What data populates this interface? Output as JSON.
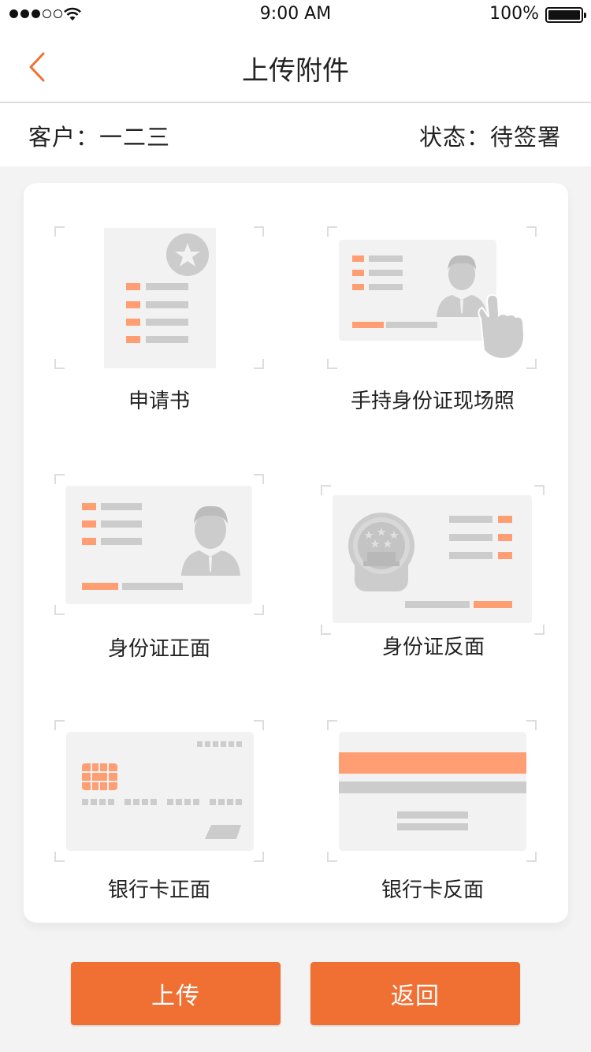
{
  "status_bar": {
    "time": "9:00 AM",
    "battery": "100%",
    "signal_icon": "signal-dots-icon",
    "wifi_icon": "wifi-icon",
    "battery_icon": "battery-icon"
  },
  "nav": {
    "title": "上传附件",
    "back_icon": "chevron-left-icon"
  },
  "info": {
    "customer_label": "客户：",
    "customer_name": "一二三",
    "status_label": "状态：",
    "status_value": "待签署"
  },
  "attachments": [
    {
      "label": "申请书",
      "icon": "application-form-icon"
    },
    {
      "label": "手持身份证现场照",
      "icon": "hand-held-id-icon"
    },
    {
      "label": "身份证正面",
      "icon": "id-card-front-icon"
    },
    {
      "label": "身份证反面",
      "icon": "id-card-back-icon"
    },
    {
      "label": "银行卡正面",
      "icon": "bank-card-front-icon"
    },
    {
      "label": "银行卡反面",
      "icon": "bank-card-back-icon"
    }
  ],
  "buttons": {
    "upload": "上传",
    "return": "返回"
  },
  "colors": {
    "accent": "#f07033",
    "accent_light": "#ff9d73",
    "placeholder_bg": "#f2f2f2",
    "placeholder_gray": "#cccccc"
  }
}
